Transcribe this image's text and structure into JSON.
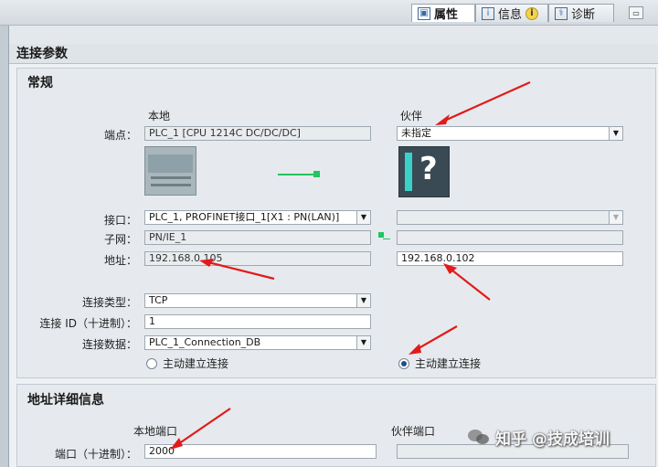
{
  "tabs": {
    "properties": "属性",
    "info": "信息",
    "diagnostics": "诊断"
  },
  "section": {
    "title": "连接参数"
  },
  "general": {
    "title": "常规",
    "local_header": "本地",
    "partner_header": "伙伴",
    "endpoint_label": "端点：",
    "local_endpoint": "PLC_1 [CPU 1214C DC/DC/DC]",
    "partner_endpoint": "未指定",
    "interface_label": "接口：",
    "local_interface": "PLC_1, PROFINET接口_1[X1 : PN(LAN)]",
    "partner_interface": "",
    "subnet_label": "子网：",
    "local_subnet": "PN/IE_1",
    "partner_subnet": "",
    "address_label": "地址：",
    "local_address": "192.168.0.105",
    "partner_address": "192.168.0.102",
    "conn_type_label": "连接类型：",
    "conn_type": "TCP",
    "conn_id_label": "连接 ID（十进制）：",
    "conn_id": "1",
    "conn_data_label": "连接数据：",
    "conn_data": "PLC_1_Connection_DB",
    "local_active_label": "主动建立连接",
    "partner_active_label": "主动建立连接",
    "local_active": false,
    "partner_active": true
  },
  "address_details": {
    "title": "地址详细信息",
    "local_port_header": "本地端口",
    "partner_port_header": "伙伴端口",
    "port_label": "端口（十进制）：",
    "local_port": "2000",
    "partner_port": ""
  },
  "watermark": "知乎 @技成培训",
  "colors": {
    "arrow": "#e21a1a",
    "link_green": "#22c55e",
    "selected_radio": "#1f4f8a"
  }
}
